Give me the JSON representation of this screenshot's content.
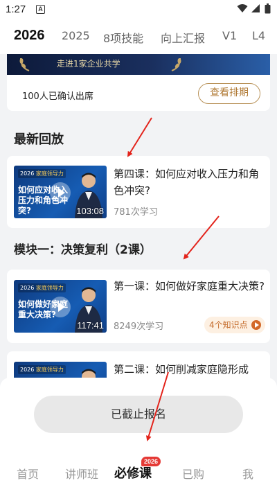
{
  "status_bar": {
    "time": "1:27",
    "notification_glyph": "A"
  },
  "top_tabs": [
    {
      "label": "2026",
      "active": true
    },
    {
      "label": "2025",
      "active": false
    },
    {
      "label": "8项技能",
      "active": false
    },
    {
      "label": "向上汇报",
      "active": false
    },
    {
      "label": "V1",
      "active": false
    },
    {
      "label": "L4",
      "active": false
    }
  ],
  "event": {
    "banner_text": "走进1家企业共学",
    "attend_text": "100人已确认出席",
    "ranking_button": "查看排期"
  },
  "latest_replay": {
    "section_title": "最新回放",
    "course": {
      "thumb_badge_year": "2026",
      "thumb_badge_name": "家庭领导力",
      "thumb_title": "如何应对收入压力和角色冲突?",
      "duration": "103:08",
      "title": "第四课：如何应对收入压力和角色冲突?",
      "stats": "781次学习"
    }
  },
  "module": {
    "section_title": "模块一：决策复利（2课）",
    "courses": [
      {
        "thumb_badge_year": "2026",
        "thumb_badge_name": "家庭领导力",
        "thumb_title": "如何做好家庭重大决策?",
        "duration": "117:41",
        "title": "第一课：如何做好家庭重大决策?",
        "stats": "8249次学习",
        "knowledge_points": "4个知识点"
      },
      {
        "thumb_badge_year": "2026",
        "thumb_badge_name": "家庭领导力",
        "title": "第二课：如何削减家庭隐形成"
      }
    ]
  },
  "signup_button": "已截止报名",
  "bottom_nav": {
    "items": [
      "首页",
      "讲师班",
      "必修课",
      "已购",
      "我"
    ],
    "active_index": 2,
    "badge": "2026"
  },
  "colors": {
    "accent_gold": "#b07a35",
    "thumb_blue": "#165cb3",
    "badge_red": "#e53935",
    "arrow_red": "#e3231b"
  }
}
